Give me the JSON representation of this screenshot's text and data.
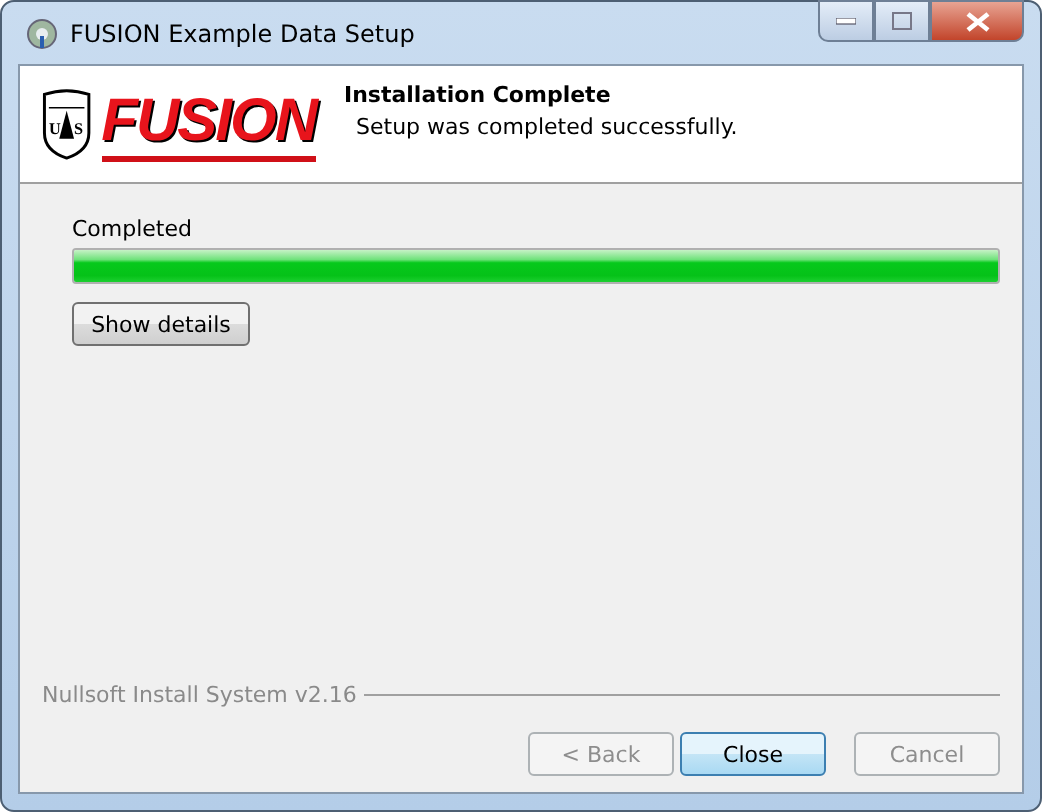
{
  "window": {
    "title": "FUSION Example Data Setup"
  },
  "header": {
    "logo_text": "FUSION",
    "shield_letters": [
      "U",
      "S"
    ],
    "title": "Installation Complete",
    "subtitle": "Setup was completed successfully."
  },
  "progress": {
    "label": "Completed",
    "level": 1
  },
  "details_button": {
    "label": "Show details"
  },
  "branding": "Nullsoft Install System v2.16",
  "buttons": [
    {
      "label": "< Back",
      "disabled": true,
      "default": false
    },
    {
      "label": "Close",
      "disabled": false,
      "default": true
    },
    {
      "label": "Cancel",
      "disabled": true,
      "default": false
    }
  ]
}
